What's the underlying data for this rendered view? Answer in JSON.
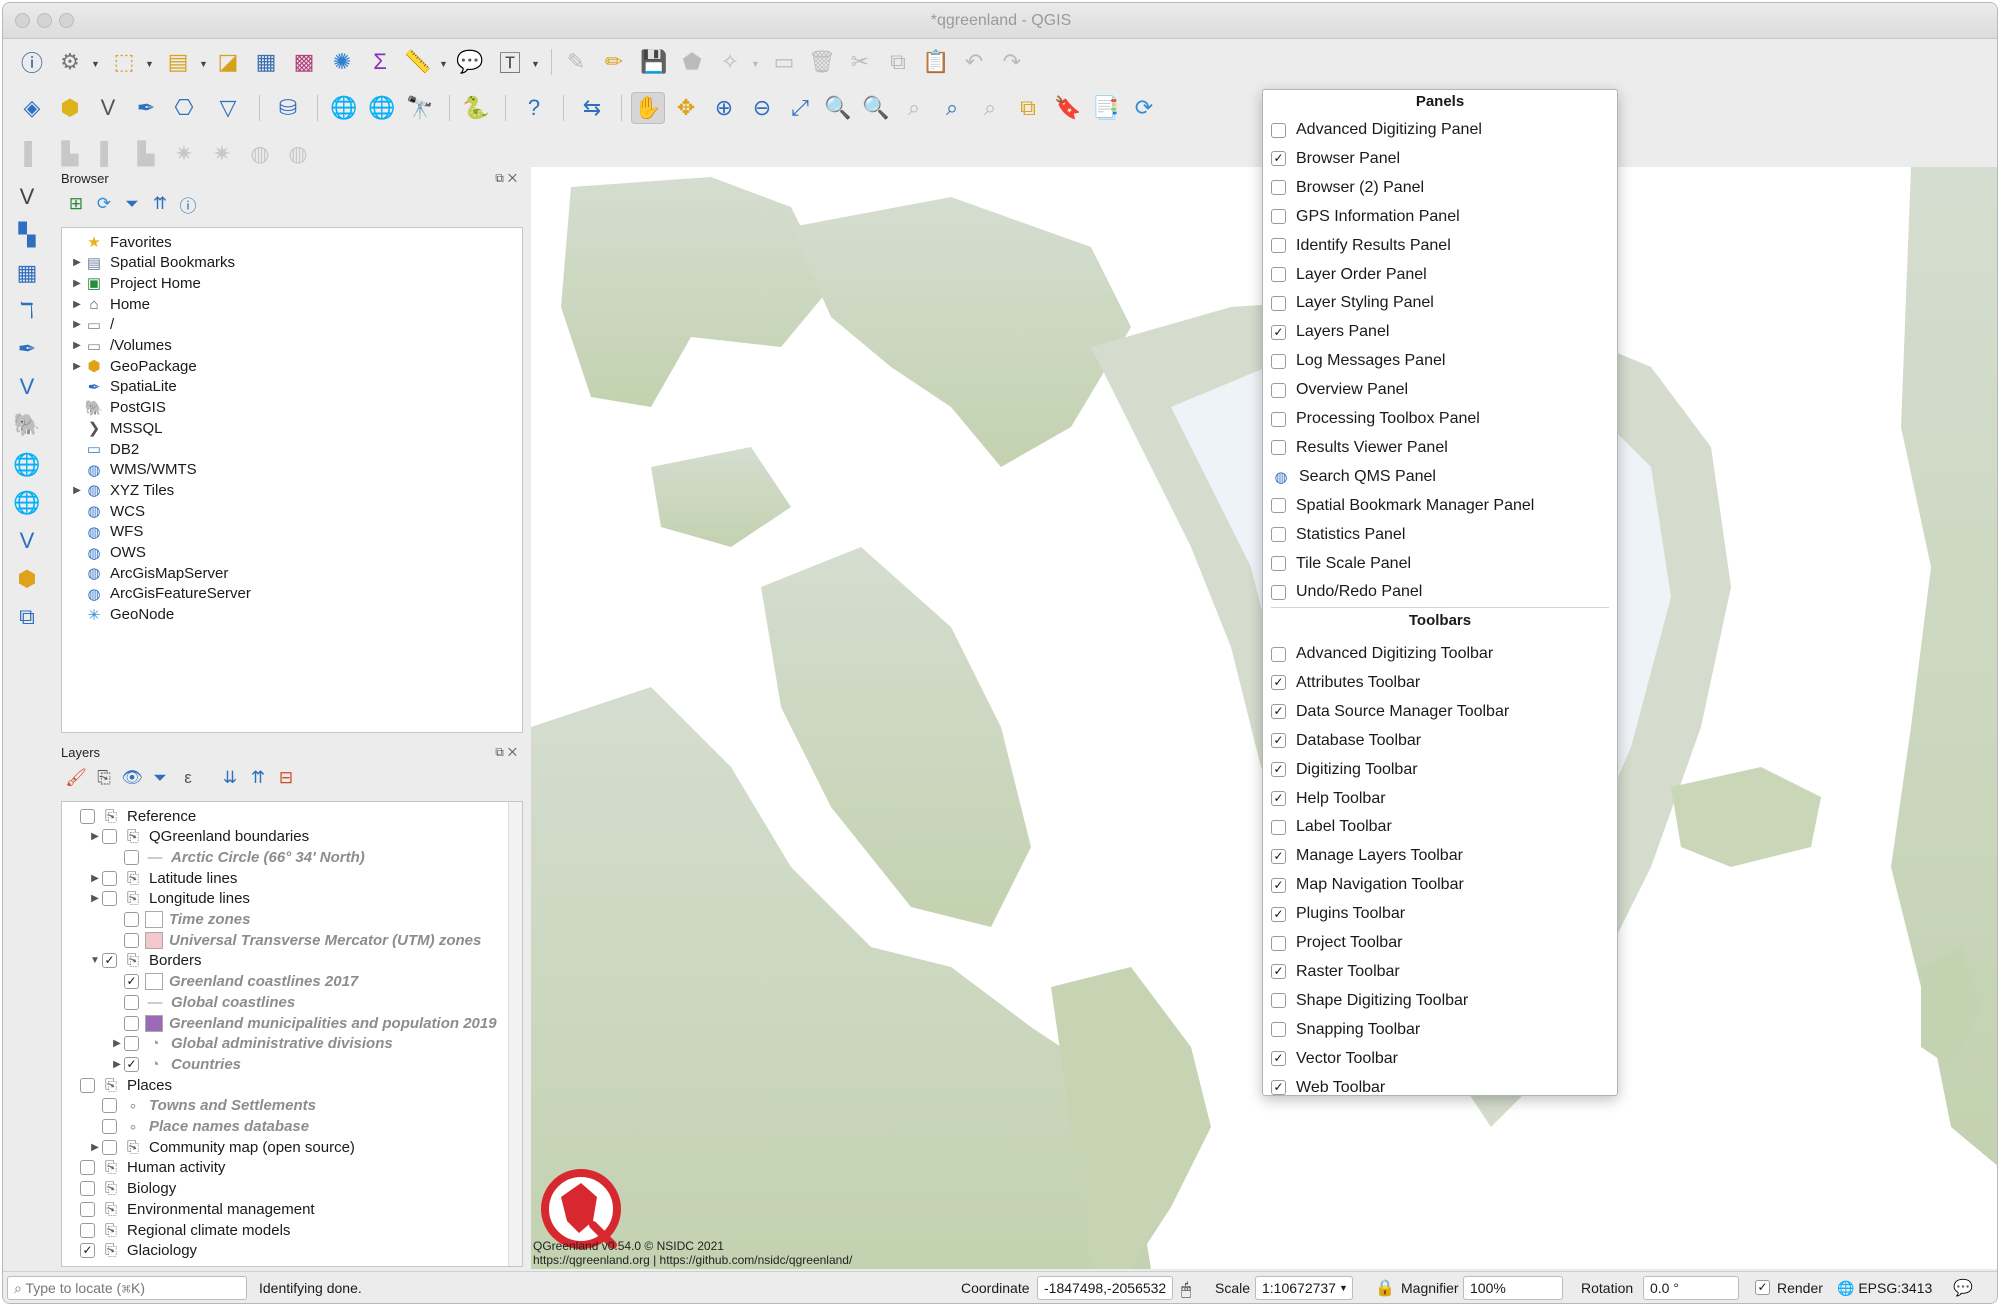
{
  "window": {
    "title": "*qgreenland - QGIS"
  },
  "browser_panel": {
    "title": "Browser",
    "items": [
      {
        "label": "Favorites",
        "icon": "star-icon",
        "expandable": false
      },
      {
        "label": "Spatial Bookmarks",
        "icon": "bookmark-icon",
        "expandable": true
      },
      {
        "label": "Project Home",
        "icon": "project-home-icon",
        "expandable": true
      },
      {
        "label": "Home",
        "icon": "home-folder-icon",
        "expandable": true
      },
      {
        "label": "/",
        "icon": "folder-icon",
        "expandable": true
      },
      {
        "label": "/Volumes",
        "icon": "folder-icon",
        "expandable": true
      },
      {
        "label": "GeoPackage",
        "icon": "geopackage-icon",
        "expandable": true
      },
      {
        "label": "SpatiaLite",
        "icon": "feather-icon",
        "expandable": false
      },
      {
        "label": "PostGIS",
        "icon": "elephant-icon",
        "expandable": false
      },
      {
        "label": "MSSQL",
        "icon": "mssql-icon",
        "expandable": false
      },
      {
        "label": "DB2",
        "icon": "db2-icon",
        "expandable": false
      },
      {
        "label": "WMS/WMTS",
        "icon": "globe-icon",
        "expandable": false
      },
      {
        "label": "XYZ Tiles",
        "icon": "globe-icon",
        "expandable": true
      },
      {
        "label": "WCS",
        "icon": "globe-icon",
        "expandable": false
      },
      {
        "label": "WFS",
        "icon": "globe-icon",
        "expandable": false
      },
      {
        "label": "OWS",
        "icon": "globe-icon",
        "expandable": false
      },
      {
        "label": "ArcGisMapServer",
        "icon": "globe-icon",
        "expandable": false
      },
      {
        "label": "ArcGisFeatureServer",
        "icon": "globe-icon",
        "expandable": false
      },
      {
        "label": "GeoNode",
        "icon": "geonode-icon",
        "expandable": false
      }
    ]
  },
  "layers_panel": {
    "title": "Layers",
    "rows": [
      {
        "label": "Reference",
        "checked": false,
        "style": "group"
      },
      {
        "label": "QGreenland boundaries",
        "checked": false,
        "style": "group"
      },
      {
        "label": "Arctic Circle (66° 34' North)",
        "checked": false,
        "style": "layer"
      },
      {
        "label": "Latitude lines",
        "checked": false,
        "style": "group"
      },
      {
        "label": "Longitude lines",
        "checked": false,
        "style": "group"
      },
      {
        "label": "Time zones",
        "checked": false,
        "style": "layer"
      },
      {
        "label": "Universal Transverse Mercator (UTM) zones",
        "checked": false,
        "style": "layer"
      },
      {
        "label": "Borders",
        "checked": true,
        "style": "group"
      },
      {
        "label": "Greenland coastlines 2017",
        "checked": true,
        "style": "layer"
      },
      {
        "label": "Global coastlines",
        "checked": false,
        "style": "layer"
      },
      {
        "label": "Greenland municipalities and population 2019",
        "checked": false,
        "style": "layer"
      },
      {
        "label": "Global administrative divisions",
        "checked": false,
        "style": "layer"
      },
      {
        "label": "Countries",
        "checked": true,
        "style": "layer"
      },
      {
        "label": "Places",
        "checked": false,
        "style": "group"
      },
      {
        "label": "Towns and Settlements",
        "checked": false,
        "style": "layer"
      },
      {
        "label": "Place names database",
        "checked": false,
        "style": "layer"
      },
      {
        "label": "Community map (open source)",
        "checked": false,
        "style": "group"
      },
      {
        "label": "Human activity",
        "checked": false,
        "style": "group"
      },
      {
        "label": "Biology",
        "checked": false,
        "style": "group"
      },
      {
        "label": "Environmental management",
        "checked": false,
        "style": "group"
      },
      {
        "label": "Regional climate models",
        "checked": false,
        "style": "group"
      },
      {
        "label": "Glaciology",
        "checked": true,
        "style": "group"
      }
    ]
  },
  "panels_menu": {
    "panels_header": "Panels",
    "panels": [
      {
        "label": "Advanced Digitizing Panel",
        "checked": false
      },
      {
        "label": "Browser Panel",
        "checked": true
      },
      {
        "label": "Browser (2) Panel",
        "checked": false
      },
      {
        "label": "GPS Information Panel",
        "checked": false
      },
      {
        "label": "Identify Results Panel",
        "checked": false
      },
      {
        "label": "Layer Order Panel",
        "checked": false
      },
      {
        "label": "Layer Styling Panel",
        "checked": false
      },
      {
        "label": "Layers Panel",
        "checked": true
      },
      {
        "label": "Log Messages Panel",
        "checked": false
      },
      {
        "label": "Overview Panel",
        "checked": false
      },
      {
        "label": "Processing Toolbox Panel",
        "checked": false
      },
      {
        "label": "Results Viewer Panel",
        "checked": false
      },
      {
        "label": "Search QMS Panel",
        "checked": false,
        "icon": "qms-globe-icon"
      },
      {
        "label": "Spatial Bookmark Manager Panel",
        "checked": false
      },
      {
        "label": "Statistics Panel",
        "checked": false
      },
      {
        "label": "Tile Scale Panel",
        "checked": false
      },
      {
        "label": "Undo/Redo Panel",
        "checked": false
      }
    ],
    "toolbars_header": "Toolbars",
    "toolbars": [
      {
        "label": "Advanced Digitizing Toolbar",
        "checked": false
      },
      {
        "label": "Attributes Toolbar",
        "checked": true
      },
      {
        "label": "Data Source Manager Toolbar",
        "checked": true
      },
      {
        "label": "Database Toolbar",
        "checked": true
      },
      {
        "label": "Digitizing Toolbar",
        "checked": true
      },
      {
        "label": "Help Toolbar",
        "checked": true
      },
      {
        "label": "Label Toolbar",
        "checked": false
      },
      {
        "label": "Manage Layers Toolbar",
        "checked": true
      },
      {
        "label": "Map Navigation Toolbar",
        "checked": true
      },
      {
        "label": "Plugins Toolbar",
        "checked": true
      },
      {
        "label": "Project Toolbar",
        "checked": false
      },
      {
        "label": "Raster Toolbar",
        "checked": true
      },
      {
        "label": "Shape Digitizing Toolbar",
        "checked": false
      },
      {
        "label": "Snapping Toolbar",
        "checked": false
      },
      {
        "label": "Vector Toolbar",
        "checked": true
      },
      {
        "label": "Web Toolbar",
        "checked": true
      }
    ]
  },
  "map": {
    "credit_line1": "QGreenland v0.54.0 © NSIDC 2021",
    "credit_line2": "https://qgreenland.org | https://github.com/nsidc/qgreenland/"
  },
  "status_bar": {
    "locator_placeholder": "Type to locate (⌘K)",
    "message": "Identifying done.",
    "coordinate_label": "Coordinate",
    "coordinate_value": "-1847498,-2056532",
    "scale_label": "Scale",
    "scale_value": "1:10672737",
    "magnifier_label": "Magnifier",
    "magnifier_value": "100%",
    "rotation_label": "Rotation",
    "rotation_value": "0.0 °",
    "render_label": "Render",
    "render_checked": true,
    "crs": "EPSG:3413"
  },
  "colors": {
    "ocean": "#ffffff",
    "land": "#c9d6b8",
    "ice": "#eef3f7",
    "logo_red": "#d8282f"
  }
}
